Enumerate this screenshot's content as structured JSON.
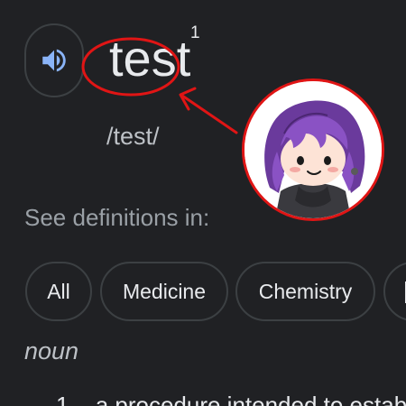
{
  "entry": {
    "word": "test",
    "sense_number": "1",
    "pronunciation": "/test/"
  },
  "audio_button": {
    "icon": "speaker-icon",
    "color": "#8ab4f8"
  },
  "see_definitions": {
    "label": "See definitions in:",
    "chips": [
      {
        "label": "All"
      },
      {
        "label": "Medicine"
      },
      {
        "label": "Chemistry"
      }
    ]
  },
  "part_of_speech": "noun",
  "definitions": [
    {
      "number": "1.",
      "text": "a procedure intended to establish"
    }
  ],
  "annotation": {
    "color": "#e01515",
    "avatar": "anime-character-avatar"
  }
}
